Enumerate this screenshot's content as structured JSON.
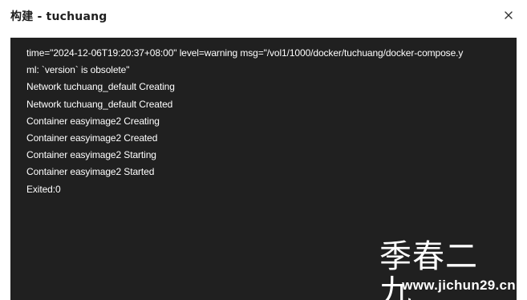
{
  "dialog": {
    "title": "构建 - tuchuang",
    "close_icon": "close-icon"
  },
  "terminal": {
    "lines": [
      "time=\"2024-12-06T19:20:37+08:00\" level=warning msg=\"/vol1/1000/docker/tuchuang/docker-compose.y",
      "ml: `version` is obsolete\"",
      "Network tuchuang_default Creating",
      "Network tuchuang_default Created",
      "Container easyimage2 Creating",
      "Container easyimage2 Created",
      "Container easyimage2 Starting",
      "Container easyimage2 Started",
      "Exited:0"
    ]
  },
  "watermark": {
    "text": "季春二九",
    "url": "www.jichun29.cn"
  }
}
